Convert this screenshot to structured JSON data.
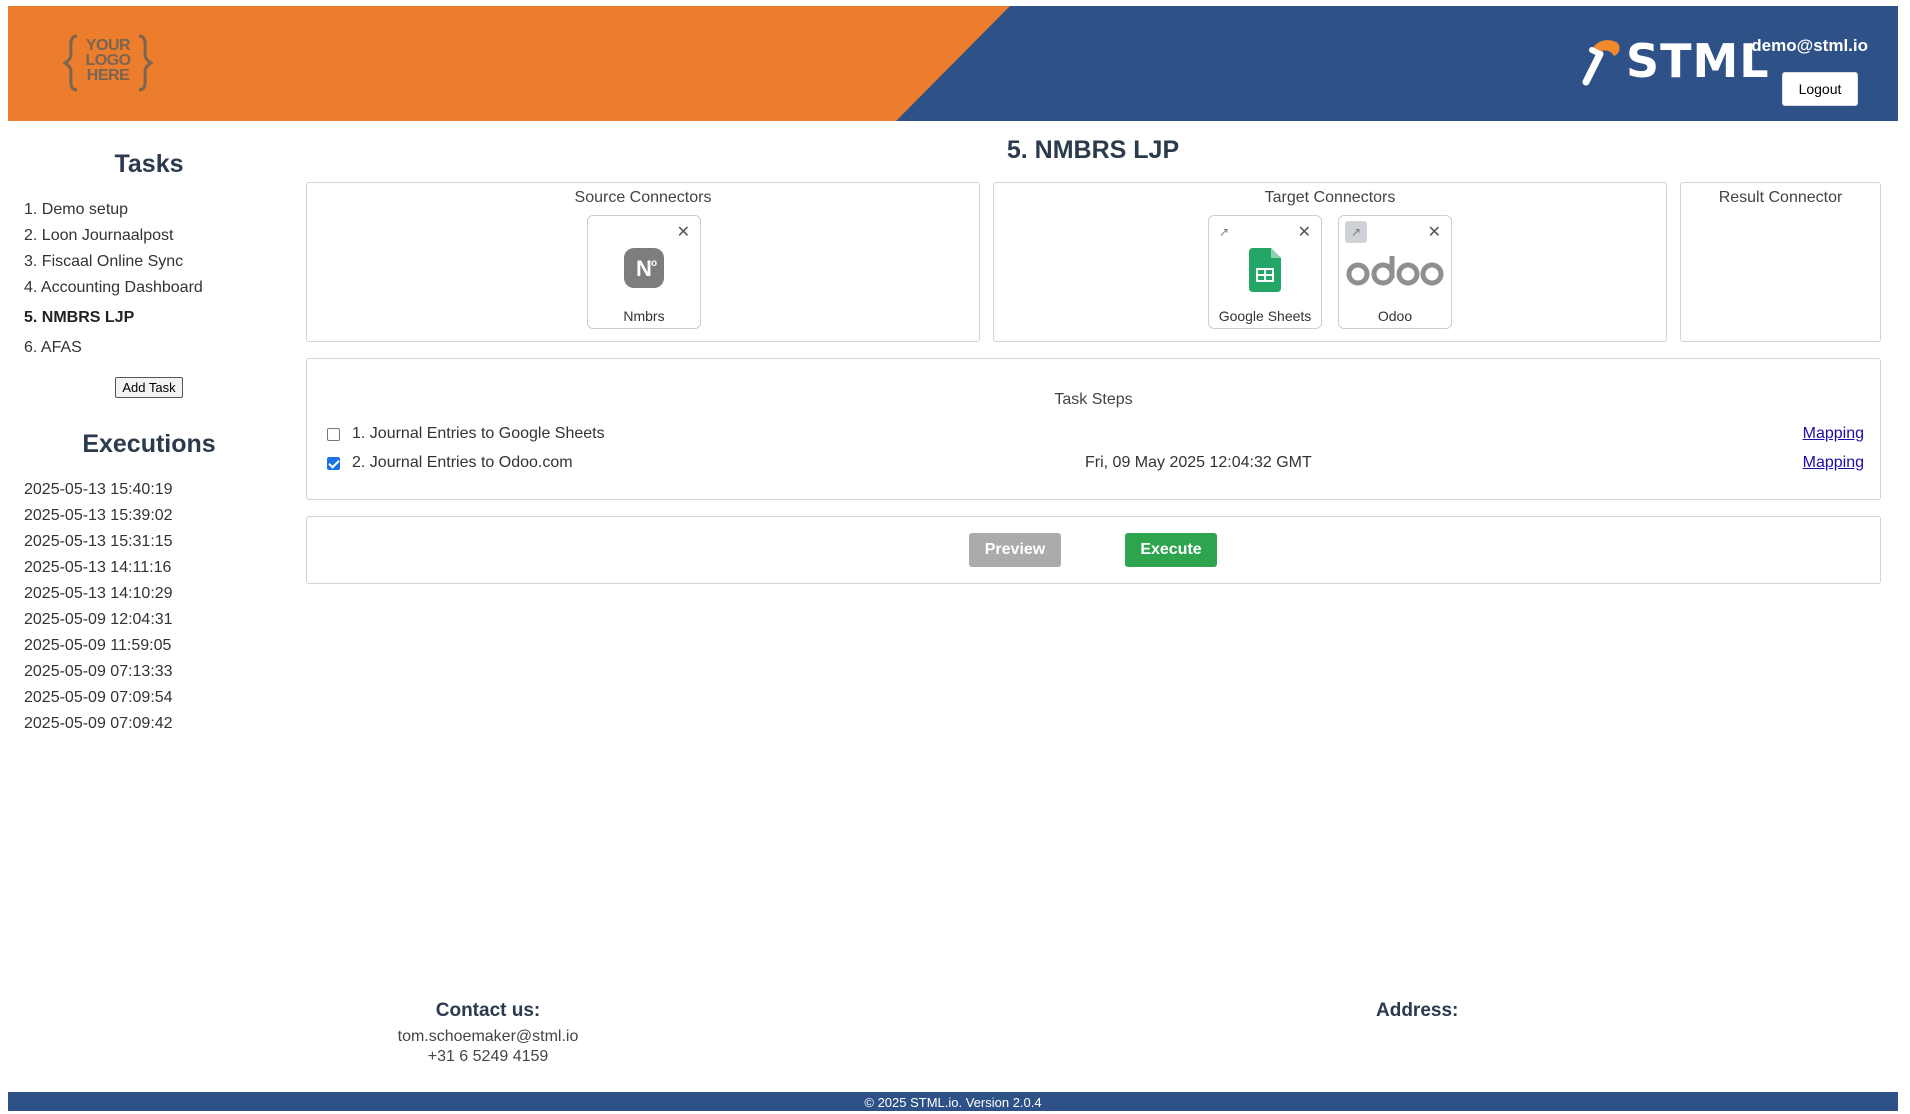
{
  "header": {
    "logo_text": [
      "YOUR",
      "LOGO",
      "HERE"
    ],
    "brand_name": "STML",
    "user_email": "demo@stml.io",
    "logout_label": "Logout",
    "colors": {
      "orange": "#ec7d2c",
      "navy": "#2e5288"
    }
  },
  "sidebar": {
    "tasks_heading": "Tasks",
    "tasks": [
      "1. Demo setup",
      "2. Loon Journaalpost",
      "3. Fiscaal Online Sync",
      "4. Accounting Dashboard",
      "5. NMBRS LJP",
      "6. AFAS"
    ],
    "active_task_index": 4,
    "add_task_label": "Add Task",
    "executions_heading": "Executions",
    "executions": [
      "2025-05-13 15:40:19",
      "2025-05-13 15:39:02",
      "2025-05-13 15:31:15",
      "2025-05-13 14:11:16",
      "2025-05-13 14:10:29",
      "2025-05-09 12:04:31",
      "2025-05-09 11:59:05",
      "2025-05-09 07:13:33",
      "2025-05-09 07:09:54",
      "2025-05-09 07:09:42"
    ]
  },
  "main": {
    "page_title": "5. NMBRS LJP",
    "source": {
      "title": "Source Connectors",
      "connectors": [
        {
          "label": "Nmbrs",
          "icon": "nmbrs-logo"
        }
      ]
    },
    "target": {
      "title": "Target Connectors",
      "connectors": [
        {
          "label": "Google Sheets",
          "icon": "google-sheets-logo"
        },
        {
          "label": "Odoo",
          "icon": "odoo-logo"
        }
      ]
    },
    "result": {
      "title": "Result Connector"
    },
    "steps": {
      "title": "Task Steps",
      "items": [
        {
          "label": "1. Journal Entries to Google Sheets",
          "checked": false,
          "date": "",
          "link": "Mapping"
        },
        {
          "label": "2. Journal Entries to Odoo.com",
          "checked": true,
          "date": "Fri, 09 May 2025 12:04:32 GMT",
          "link": "Mapping"
        }
      ]
    },
    "actions": {
      "preview_label": "Preview",
      "execute_label": "Execute"
    }
  },
  "footer": {
    "contact_heading": "Contact us:",
    "email": "tom.schoemaker@stml.io",
    "phone": "+31 6 5249 4159",
    "address_heading": "Address:",
    "copyright": "© 2025 STML.io. Version 2.0.4"
  }
}
